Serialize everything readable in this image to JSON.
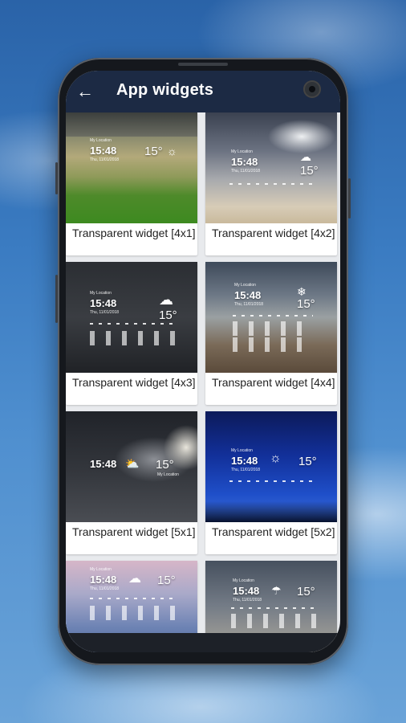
{
  "appbar": {
    "title": "App widgets",
    "back_icon": "arrow-left-icon"
  },
  "widgets": [
    {
      "label": "Transparent widget [4x1]",
      "time": "15:48",
      "temp": "15°",
      "loc": "My Location",
      "date": "Thu, 11/01/2018"
    },
    {
      "label": "Transparent widget [4x2]",
      "time": "15:48",
      "temp": "15°",
      "loc": "My Location",
      "date": "Thu, 11/01/2018"
    },
    {
      "label": "Transparent widget [4x3]",
      "time": "15:48",
      "temp": "15°",
      "loc": "My Location",
      "date": "Thu, 11/01/2018"
    },
    {
      "label": "Transparent widget [4x4]",
      "time": "15:48",
      "temp": "15°",
      "loc": "My Location",
      "date": "Thu, 11/01/2018"
    },
    {
      "label": "Transparent widget [5x1]",
      "time": "15:48",
      "temp": "15°",
      "loc": "My Location",
      "date": ""
    },
    {
      "label": "Transparent widget [5x2]",
      "time": "15:48",
      "temp": "15°",
      "loc": "My Location",
      "date": "Thu, 11/01/2018"
    },
    {
      "label": "",
      "time": "15:48",
      "temp": "15°",
      "loc": "My Location",
      "date": "Thu, 11/01/2018"
    },
    {
      "label": "",
      "time": "15:48",
      "temp": "15°",
      "loc": "My Location",
      "date": "Thu, 11/01/2018"
    }
  ]
}
